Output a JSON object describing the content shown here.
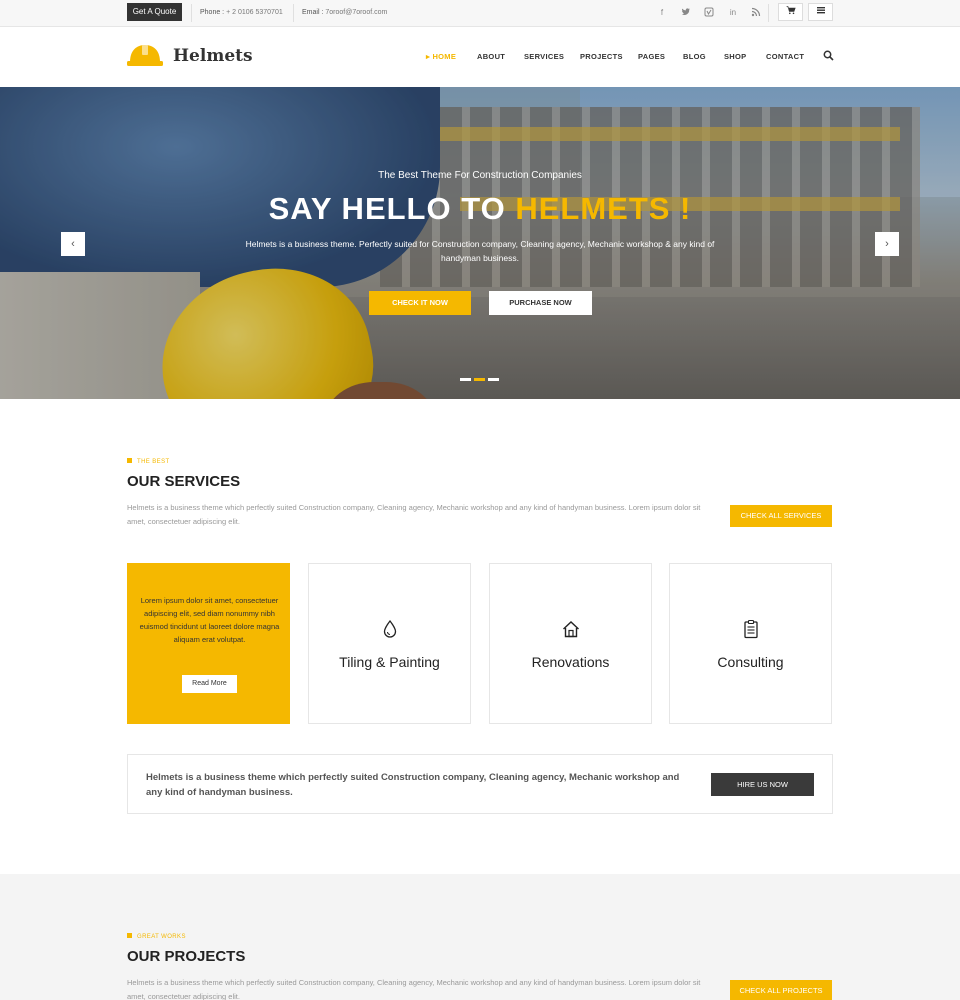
{
  "topbar": {
    "quote_label": "Get A Quote",
    "phone_label": "Phone :",
    "phone_value": "+ 2 0106 5370701",
    "email_label": "Email :",
    "email_value": "7oroof@7oroof.com"
  },
  "header": {
    "logo_text": "Helmets",
    "nav": [
      "HOME",
      "ABOUT",
      "SERVICES",
      "PROJECTS",
      "PAGES",
      "BLOG",
      "SHOP",
      "CONTACT"
    ],
    "active_nav": "HOME"
  },
  "hero": {
    "subtitle": "The Best Theme For Construction Companies",
    "title_main": "SAY HELLO TO ",
    "title_accent": "HELMETS !",
    "description": "Helmets is a business theme. Perfectly suited for Construction company, Cleaning agency, Mechanic workshop & any kind of handyman business.",
    "btn_check": "CHECK IT NOW",
    "btn_purchase": "PURCHASE NOW",
    "slide_count": 3,
    "active_slide": 2
  },
  "services": {
    "eyebrow": "THE BEST",
    "title": "OUR SERVICES",
    "description": "Helmets is a business theme which perfectly suited Construction company, Cleaning agency, Mechanic workshop and any kind of handyman business. Lorem ipsum dolor sit amet, consectetuer adipiscing elit.",
    "btn_label": "CHECK ALL SERVICES",
    "featured_text": "Lorem ipsum dolor sit amet, consectetuer adipiscing elit, sed diam nonummy nibh euismod tincidunt ut laoreet dolore magna aliquam erat volutpat.",
    "read_more": "Read More",
    "cards": [
      {
        "title": "Tiling & Painting",
        "icon": "drop-icon"
      },
      {
        "title": "Renovations",
        "icon": "house-icon"
      },
      {
        "title": "Consulting",
        "icon": "clipboard-icon"
      }
    ]
  },
  "hire": {
    "text": "Helmets is a business theme which perfectly suited Construction company, Cleaning agency, Mechanic workshop and any kind of handyman business.",
    "btn_label": "HIRE US NOW"
  },
  "projects": {
    "eyebrow": "GREAT WORKS",
    "title": "OUR PROJECTS",
    "description": "Helmets is a business theme which perfectly suited Construction company, Cleaning agency, Mechanic workshop and any kind of handyman business. Lorem ipsum dolor sit amet, consectetuer adipiscing elit.",
    "btn_label": "CHECK ALL PROJECTS"
  },
  "colors": {
    "accent": "#f5b800",
    "dark": "#333333"
  }
}
